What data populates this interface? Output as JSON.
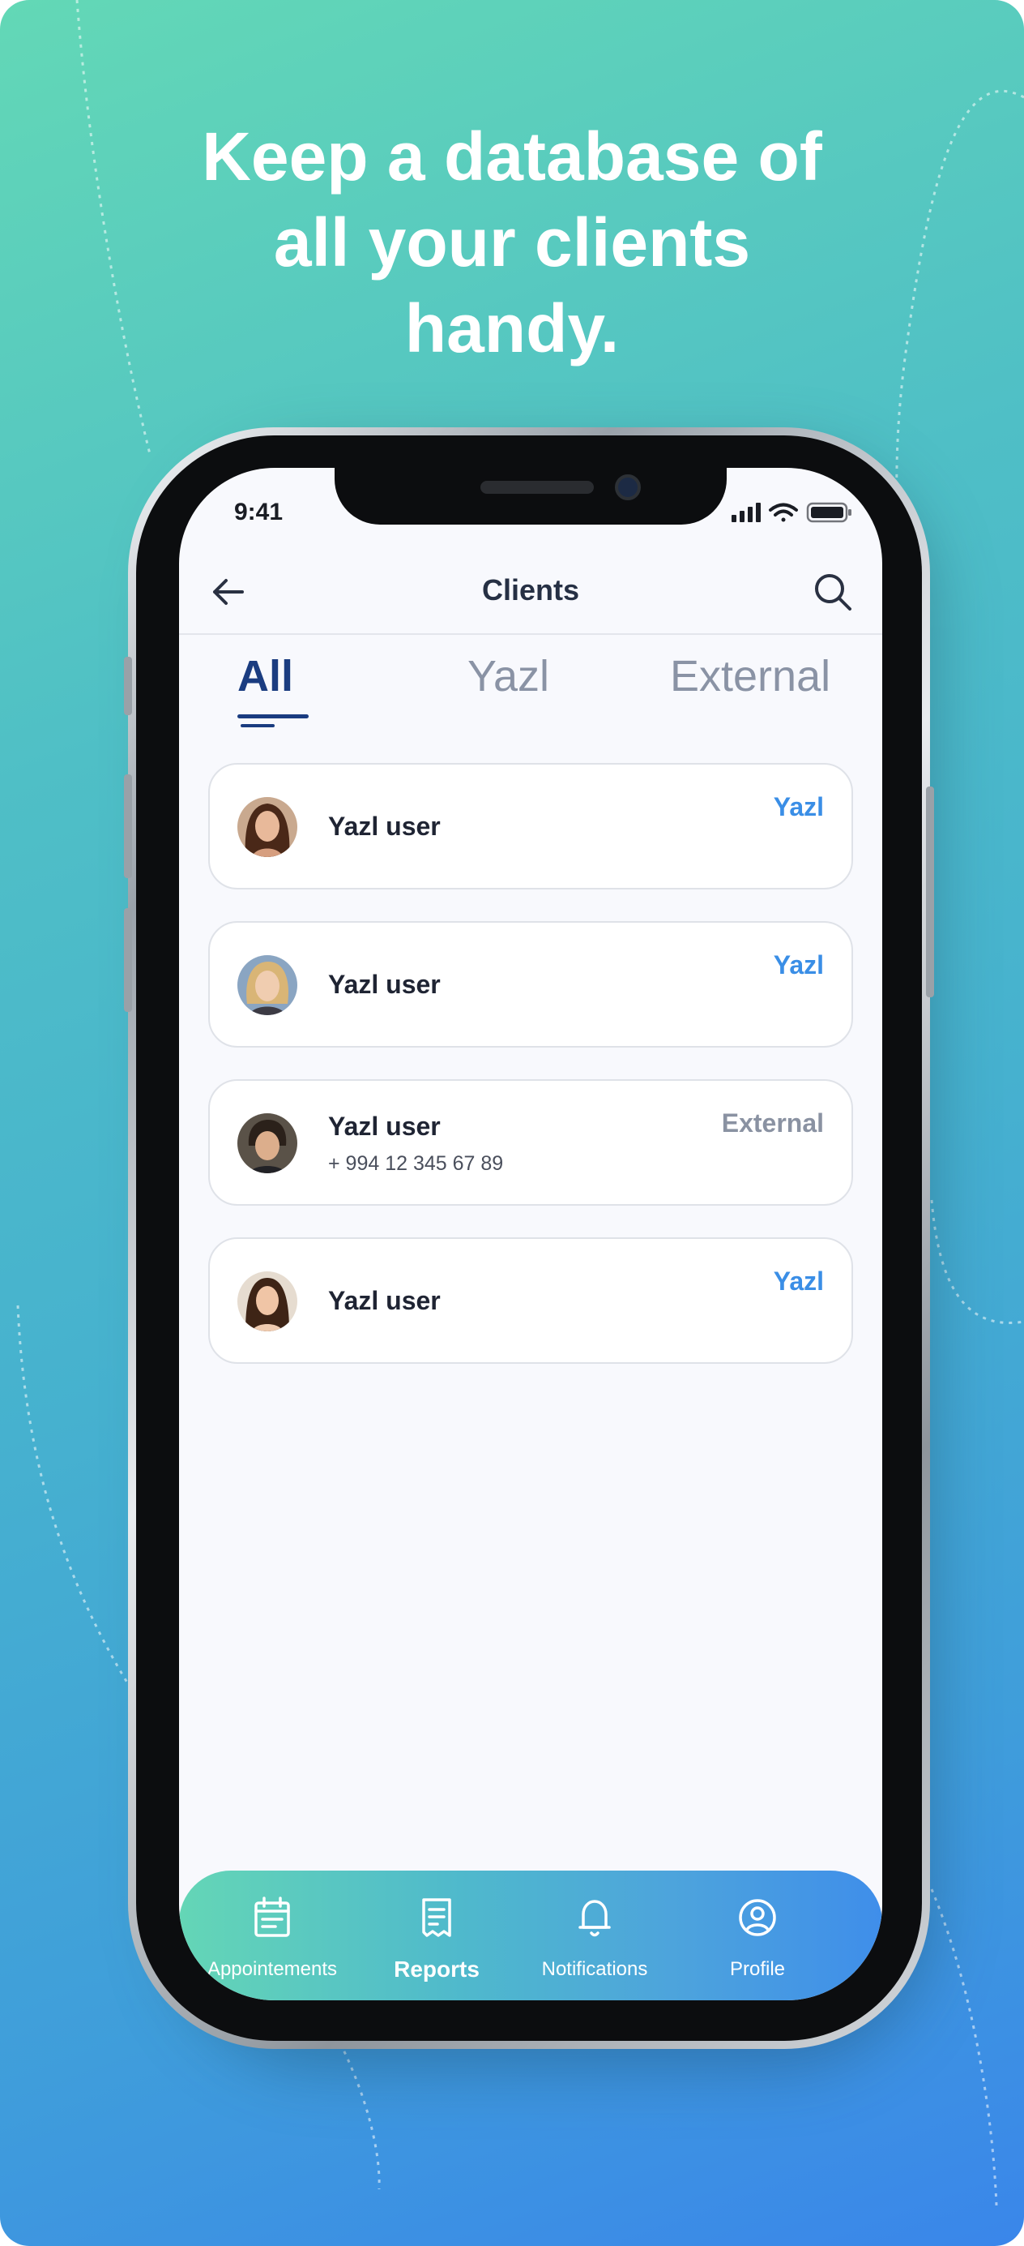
{
  "headline": [
    "Keep a database of",
    "all your clients",
    "handy."
  ],
  "status_bar": {
    "time": "9:41",
    "icons": [
      "signal-icon",
      "wifi-icon",
      "battery-icon"
    ]
  },
  "app_bar": {
    "title": "Clients",
    "back_icon": "arrow-left-icon",
    "search_icon": "search-icon"
  },
  "tabs": [
    {
      "label": "All",
      "active": true
    },
    {
      "label": "Yazl",
      "active": false
    },
    {
      "label": "External",
      "active": false
    }
  ],
  "clients": [
    {
      "name": "Yazl user",
      "phone": "",
      "tag": "Yazl"
    },
    {
      "name": "Yazl user",
      "phone": "",
      "tag": "Yazl"
    },
    {
      "name": "Yazl user",
      "phone": "+ 994 12 345 67 89",
      "tag": "External"
    },
    {
      "name": "Yazl user",
      "phone": "",
      "tag": "Yazl"
    }
  ],
  "bottom_nav": [
    {
      "label": "Appointements",
      "icon": "calendar-icon",
      "active": false
    },
    {
      "label": "Reports",
      "icon": "receipt-icon",
      "active": true
    },
    {
      "label": "Notifications",
      "icon": "bell-icon",
      "active": false
    },
    {
      "label": "Profile",
      "icon": "user-circle-icon",
      "active": false
    }
  ],
  "colors": {
    "accent": "#1a3c80",
    "tag_yazl": "#3a8ee6",
    "tag_external": "#8a92a2",
    "gradient_start": "#63d8b6",
    "gradient_end": "#3a86ea"
  }
}
